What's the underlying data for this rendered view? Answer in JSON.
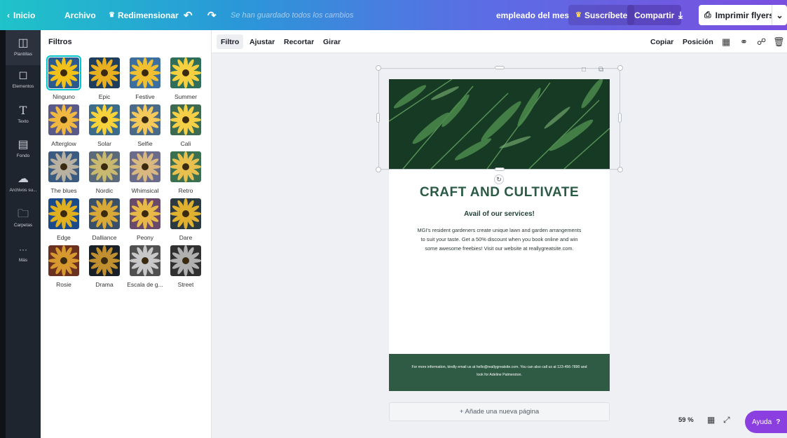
{
  "topbar": {
    "home": "Inicio",
    "file": "Archivo",
    "resize": "Redimensionar",
    "saved_status": "Se han guardado todos los cambios",
    "design_title": "empleado del mes",
    "subscribe": "Suscríbete",
    "share": "Compartir",
    "print": "Imprimir flyers"
  },
  "sidebar": {
    "items": [
      {
        "label": "Plantillas",
        "icon": "template-icon"
      },
      {
        "label": "Elementos",
        "icon": "shapes-icon"
      },
      {
        "label": "Texto",
        "icon": "text-icon"
      },
      {
        "label": "Fondo",
        "icon": "background-icon"
      },
      {
        "label": "Archivos su...",
        "icon": "upload-icon"
      },
      {
        "label": "Carpetas",
        "icon": "folder-icon"
      },
      {
        "label": "Más",
        "icon": "more-icon"
      }
    ]
  },
  "panel": {
    "title": "Filtros",
    "filters": [
      "Ninguno",
      "Epic",
      "Festive",
      "Summer",
      "Afterglow",
      "Solar",
      "Selfie",
      "Cali",
      "The blues",
      "Nordic",
      "Whimsical",
      "Retro",
      "Edge",
      "Dalliance",
      "Peony",
      "Dare",
      "Rosie",
      "Drama",
      "Escala de g...",
      "Street"
    ]
  },
  "toolbar": {
    "filter": "Filtro",
    "adjust": "Ajustar",
    "crop": "Recortar",
    "rotate": "Girar",
    "copy": "Copiar",
    "position": "Posición"
  },
  "design": {
    "headline": "CRAFT AND CULTIVATE",
    "subhead": "Avail of our services!",
    "body": "MGI's resident gardeners create unique lawn and garden arrangements to suit your taste. Get a 50% discount when you book online and win some awesome freebies! Visit our website at reallygreatsite.com.",
    "footer": "For more information, kindly email us at hello@reallygreatsite.com. You can also call us at 123-456-7890 and look for Adeline Palmerston."
  },
  "canvas": {
    "add_page": "+ Añade una nueva página",
    "zoom": "59 %",
    "help": "Ayuda"
  },
  "colors": {
    "accent": "#00c4cc",
    "headline": "#2b5a45",
    "footer_bg": "#2f5b45",
    "help_bg": "#8b3fe0"
  }
}
